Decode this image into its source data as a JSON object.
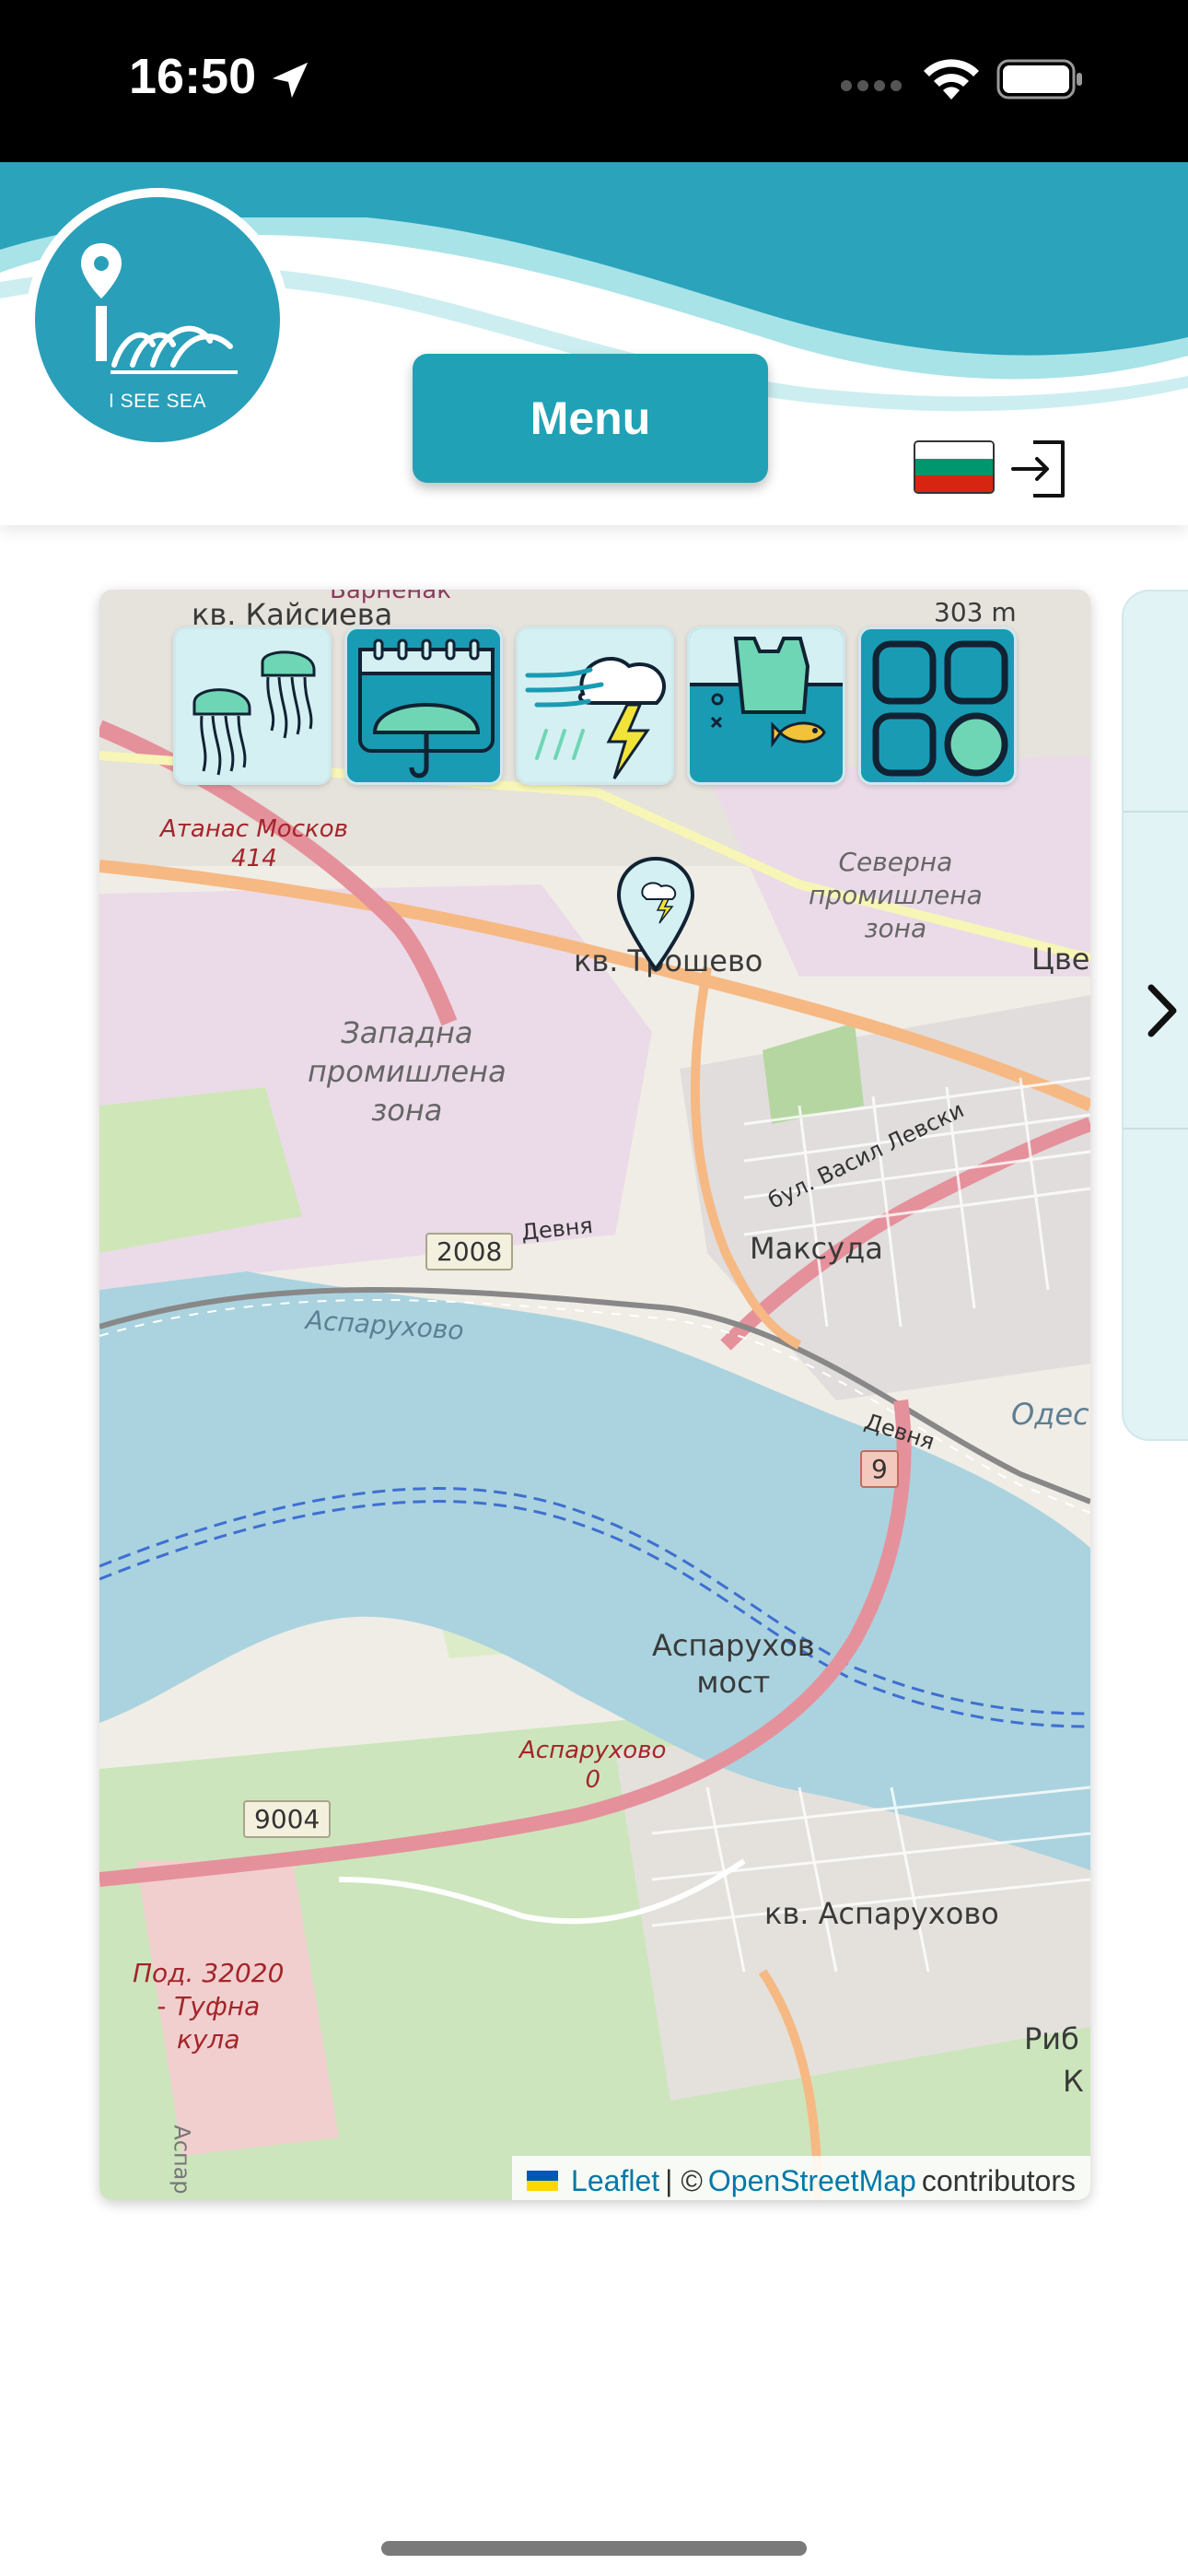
{
  "status_bar": {
    "time": "16:50"
  },
  "header": {
    "logo_caption": "I SEE SEA",
    "menu_label": "Menu",
    "language_flag": "bulgaria-flag",
    "login_icon": "login-icon"
  },
  "colors": {
    "brand_teal": "#21a1b6",
    "light_teal": "#a8e3e8",
    "map_water": "#aad3df",
    "map_industrial": "#ebdbe8"
  },
  "map": {
    "category_icons": [
      "jellyfish-icon",
      "umbrella-calendar-icon",
      "storm-icon",
      "pollution-icon",
      "grid-icon"
    ],
    "marker_icon": "storm-marker-icon",
    "labels": {
      "kv_kaysieva": "кв. Кайсиева",
      "barnevo": "Варненак",
      "elev_303": "303 m",
      "atanas_moskov": "Атанас Москов",
      "atanas_moskov_num": "414",
      "severna_zone": "Северна\nпромишлена\nзона",
      "kv_troshevo": "кв. Трошево",
      "tsve": "Цве",
      "zapadna_zone": "Западна\nпромишлена\nзона",
      "bul_vasil_levski": "бул. Васил Левски",
      "maksuda": "Максуда",
      "devnya_1": "Девня",
      "devnya_2": "Девня",
      "asparuhovo_water": "Аспарухово",
      "odesa": "Одеса",
      "asparuhov_most": "Аспарухов\nмост",
      "asparuhovo_rail": "Аспарухово",
      "asparuhovo_rail_num": "0",
      "kv_asparuhovo": "кв. Аспарухово",
      "pod_tufna": "Под. 32020\n- Туфна\nкула",
      "riba": "Риб",
      "ka": "К",
      "aspar_vertical": "Аспар"
    },
    "road_shields": {
      "r2008": "2008",
      "r9": "9",
      "r9004": "9004"
    },
    "attribution": {
      "leaflet": "Leaflet",
      "separator": "| ©",
      "osm": "OpenStreetMap",
      "contributors": "contributors"
    }
  },
  "side_panel": {
    "chevron_icon": "chevron-right-icon"
  }
}
